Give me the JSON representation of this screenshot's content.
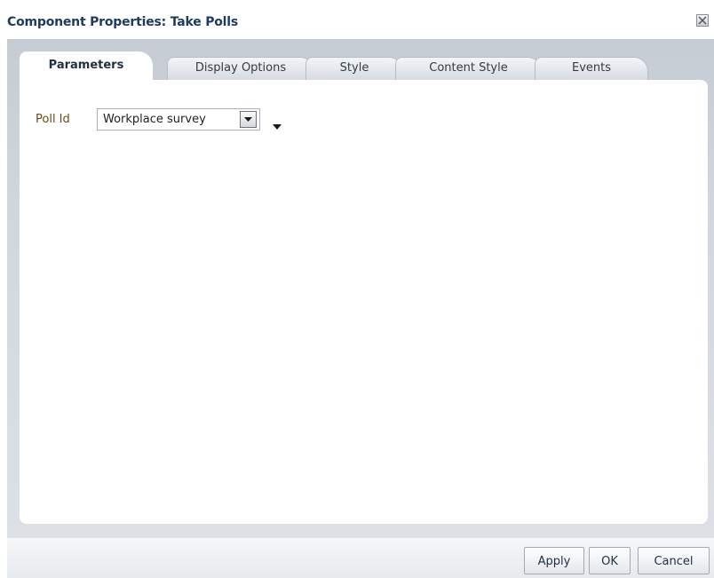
{
  "dialog": {
    "title": "Component Properties: Take Polls",
    "close_icon": "close-x-icon"
  },
  "tabs": [
    {
      "label": "Parameters",
      "active": true
    },
    {
      "label": "Display Options",
      "active": false
    },
    {
      "label": "Style",
      "active": false
    },
    {
      "label": "Content Style",
      "active": false
    },
    {
      "label": "Events",
      "active": false
    }
  ],
  "parameters": {
    "poll_id_label": "Poll Id",
    "poll_id_value": "Workplace survey",
    "dropdown_icon": "chevron-down-icon",
    "menu_icon": "caret-down-icon"
  },
  "footer": {
    "apply_label": "Apply",
    "ok_label": "OK",
    "cancel_label": "Cancel"
  },
  "colors": {
    "title": "#1f3a5f",
    "field_label": "#6b4a16",
    "content_background": "#cfd4db",
    "panel_background": "#ffffff"
  }
}
